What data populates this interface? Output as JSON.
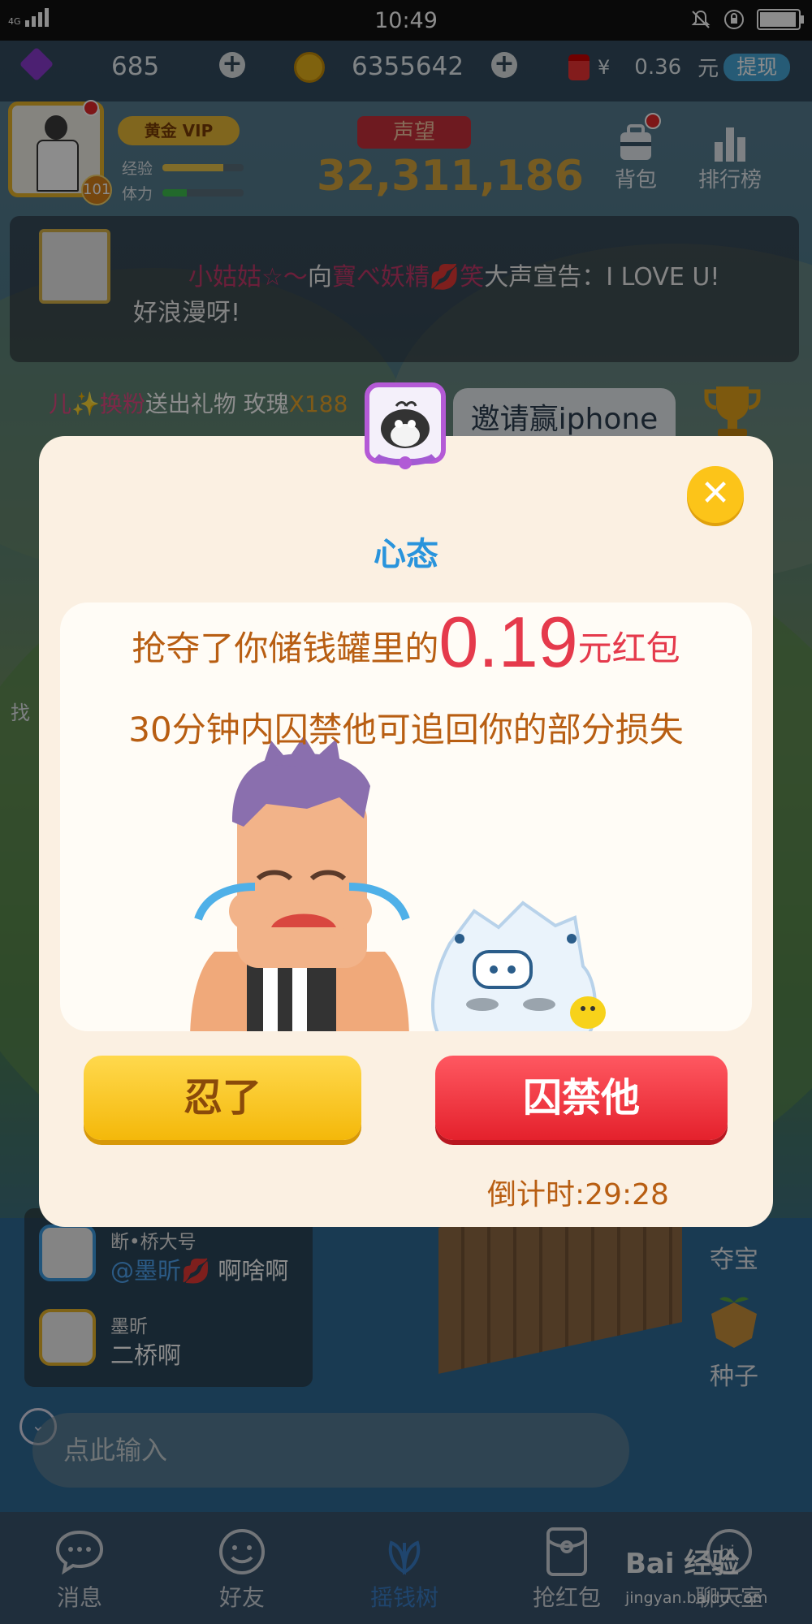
{
  "status": {
    "network": "4G",
    "time": "10:49"
  },
  "currency": {
    "gems": "685",
    "coins": "6355642",
    "cash_symbol": "¥",
    "cash": "0.36",
    "cash_unit": "元",
    "withdraw_label": "提现"
  },
  "profile": {
    "level": "101",
    "vip_label": "黄金 VIP",
    "exp_label": "经验",
    "stamina_label": "体力",
    "exp_fill": 0.75,
    "stamina_fill": 0.3
  },
  "reputation": {
    "title": "声望",
    "value": "32,311,186"
  },
  "top_icons": [
    {
      "label": "背包",
      "icon": "backpack-icon"
    },
    {
      "label": "排行榜",
      "icon": "ranking-icon"
    }
  ],
  "announcement": {
    "sender": "小姑姑☆〜",
    "to_word": "向",
    "receiver": "寶べ妖精",
    "receiver_suffix": "笑",
    "action": "大声宣告：I LOVE U!",
    "line2": "好浪漫呀!"
  },
  "marquee": {
    "prefix": "儿✨换粉",
    "text": "送出礼物 玫瑰",
    "amount": "X188"
  },
  "invite_label": "邀请赢iphone",
  "modal": {
    "title": "心态",
    "line1_prefix": "抢夺了你储钱罐里的",
    "amount": "0.19",
    "amount_unit": "元红包",
    "line2": "30分钟内囚禁他可追回你的部分损失",
    "endure_label": "忍了",
    "jail_label": "囚禁他",
    "countdown": "倒计时:29:28"
  },
  "chat": [
    {
      "name": "断•桥大号",
      "mention": "@墨昕",
      "text": "啊啥啊"
    },
    {
      "name": "墨昕",
      "text": "二桥啊"
    }
  ],
  "side": {
    "left_label": "找",
    "grab_label": "夺宝",
    "seed_label": "种子"
  },
  "input_placeholder": "点此输入",
  "tabs": [
    {
      "label": "消息",
      "icon": "message-icon"
    },
    {
      "label": "好友",
      "icon": "friends-icon"
    },
    {
      "label": "摇钱树",
      "icon": "money-tree-icon",
      "active": true
    },
    {
      "label": "抢红包",
      "icon": "red-envelope-icon"
    },
    {
      "label": "聊天室",
      "icon": "chatroom-icon"
    }
  ],
  "watermark": {
    "brand": "Bai 经验",
    "url": "jingyan.baidu.com"
  },
  "colors": {
    "accent_blue": "#2994dc",
    "amount_red": "#e53a4c",
    "text_brown": "#b85e12",
    "gold": "#fcc419"
  }
}
